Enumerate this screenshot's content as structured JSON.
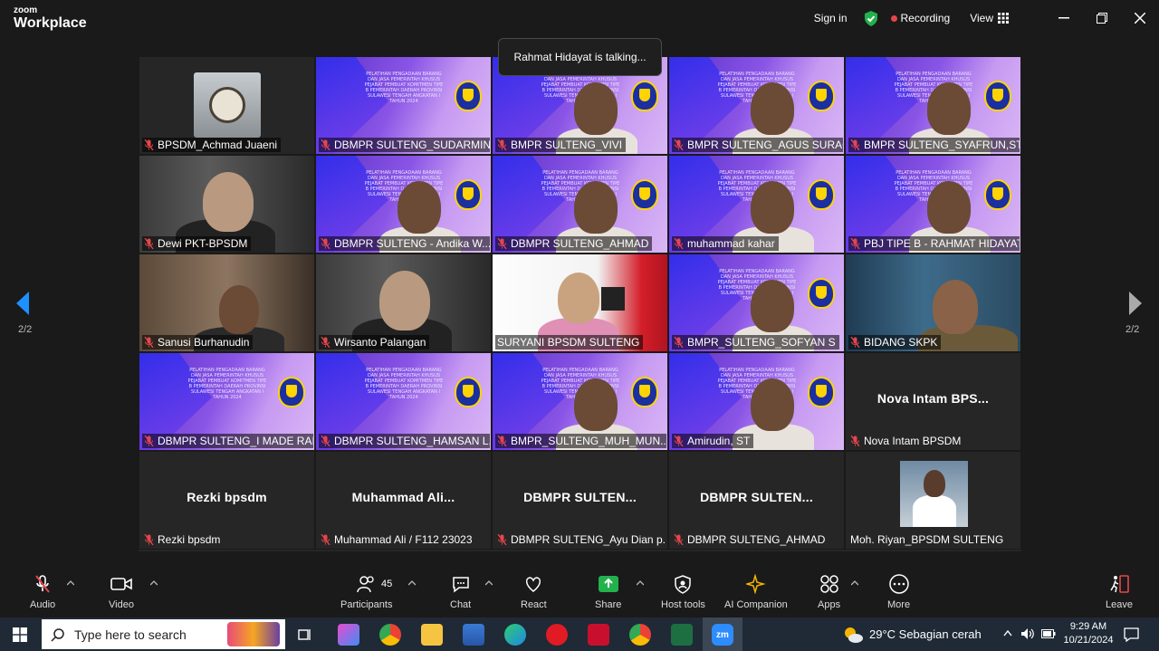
{
  "app": {
    "brand_top": "zoom",
    "brand_bottom": "Workplace"
  },
  "titlebar": {
    "sign_in": "Sign in",
    "recording": "Recording",
    "view": "View"
  },
  "talking": "Rahmat Hidayat is talking...",
  "page": {
    "left": "2/2",
    "right": "2/2"
  },
  "tiles": [
    {
      "name": "BPSDM_Achmad Juaeni"
    },
    {
      "name": "DBMPR SULTENG_SUDARMIN..."
    },
    {
      "name": "BMPR SULTENG_VIVI"
    },
    {
      "name": "BMPR SULTENG_AGUS SURAC..."
    },
    {
      "name": "BMPR SULTENG_SYAFRUN,ST"
    },
    {
      "name": "Dewi PKT-BPSDM"
    },
    {
      "name": "DBMPR SULTENG - Andika W..."
    },
    {
      "name": "DBMPR SULTENG_AHMAD"
    },
    {
      "name": "muhammad kahar"
    },
    {
      "name": "PBJ TIPE B - RAHMAT HIDAYAT"
    },
    {
      "name": "Sanusi Burhanudin"
    },
    {
      "name": "Wirsanto Palangan"
    },
    {
      "name": "SURYANI BPSDM SULTENG"
    },
    {
      "name": "BMPR_SULTENG_SOFYAN S"
    },
    {
      "name": "BIDANG SKPK"
    },
    {
      "name": "DBMPR SULTENG_I MADE RAI..."
    },
    {
      "name": "DBMPR SULTENG_HAMSAN L..."
    },
    {
      "name": "BMPR_SULTENG_MUH_MUN..."
    },
    {
      "name": "Amirudin, ST"
    },
    {
      "name": "Nova Intam BPSDM",
      "big": "Nova Intam BPS..."
    },
    {
      "name": "Rezki bpsdm",
      "big": "Rezki bpsdm"
    },
    {
      "name": "Muhammad Ali / F112 23023",
      "big": "Muhammad  Ali..."
    },
    {
      "name": "DBMPR SULTENG_Ayu Dian p...",
      "big": "DBMPR  SULTEN..."
    },
    {
      "name": "DBMPR SULTENG_AHMAD",
      "big": "DBMPR  SULTEN..."
    },
    {
      "name": "Moh. Riyan_BPSDM SULTENG"
    }
  ],
  "banner_text": "PELATIHAN PENGADAAN BARANG DAN JASA PEMERINTAH KHUSUS PEJABAT PEMBUAT KOMITMEN TIPE B PEMERINTAH DAERAH PROVINSI SULAWESI TENGAH ANGKATAN I TAHUN 2024",
  "toolbar": {
    "audio": "Audio",
    "video": "Video",
    "participants": "Participants",
    "participants_count": "45",
    "chat": "Chat",
    "react": "React",
    "share": "Share",
    "host_tools": "Host tools",
    "ai_companion": "AI Companion",
    "apps": "Apps",
    "more": "More",
    "leave": "Leave"
  },
  "taskbar": {
    "search_placeholder": "Type here to search",
    "weather": "29°C  Sebagian cerah",
    "time": "9:29 AM",
    "date": "10/21/2024"
  },
  "colors": {
    "accent_green": "#22b14c",
    "recording_red": "#e5464b",
    "mute_red": "#e5464b"
  }
}
